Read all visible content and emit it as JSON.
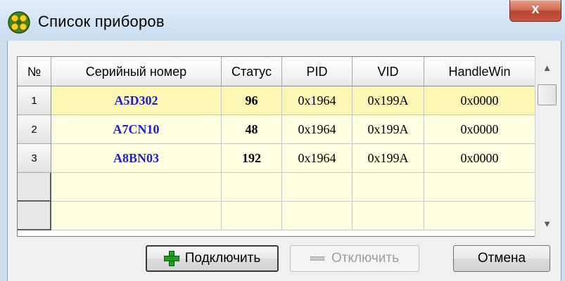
{
  "window": {
    "title": "Список приборов",
    "close_label": "x",
    "icon": "devices-app-icon"
  },
  "table": {
    "columns": [
      "№",
      "Серийный номер",
      "Статус",
      "PID",
      "VID",
      "HandleWin"
    ],
    "rows": [
      {
        "num": "1",
        "serial": "A5D302",
        "status": "96",
        "pid": "0x1964",
        "vid": "0x199A",
        "handle": "0x0000",
        "selected": true
      },
      {
        "num": "2",
        "serial": "A7CN10",
        "status": "48",
        "pid": "0x1964",
        "vid": "0x199A",
        "handle": "0x0000",
        "selected": false
      },
      {
        "num": "3",
        "serial": "A8BN03",
        "status": "192",
        "pid": "0x1964",
        "vid": "0x199A",
        "handle": "0x0000",
        "selected": false
      }
    ],
    "empty_rows": 2
  },
  "scrollbar": {
    "up_icon": "arrow-up-icon",
    "down_icon": "arrow-down-icon"
  },
  "buttons": {
    "connect_label": "Подключить",
    "disconnect_label": "Отключить",
    "cancel_label": "Отмена"
  },
  "colors": {
    "serial_text": "#1e1ed4",
    "row_background": "#ffffe1",
    "selected_row": "#fbf6b3",
    "close_button": "#c9583f"
  }
}
